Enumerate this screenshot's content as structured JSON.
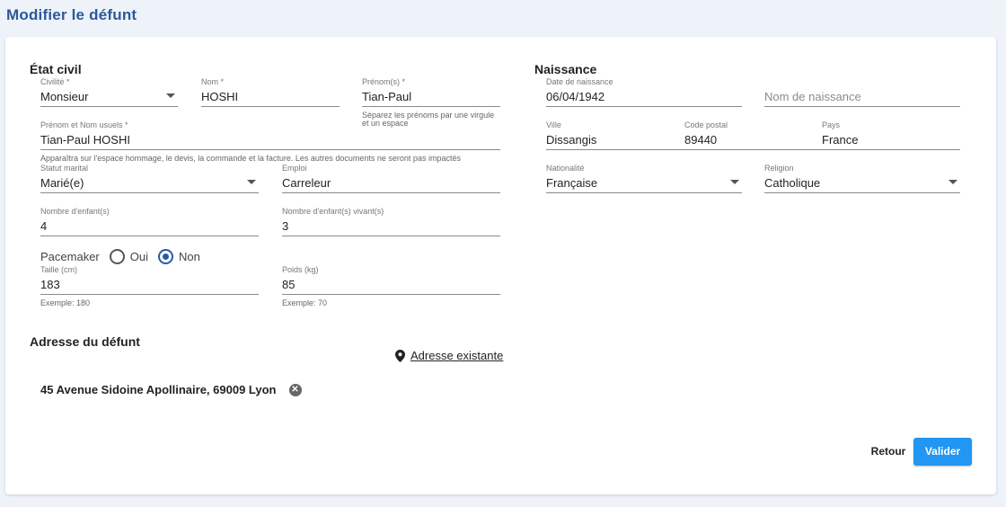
{
  "page": {
    "title": "Modifier le défunt"
  },
  "etat_civil": {
    "title": "État civil",
    "civilite": {
      "label": "Civilité *",
      "value": "Monsieur"
    },
    "nom": {
      "label": "Nom *",
      "value": "HOSHI"
    },
    "prenoms": {
      "label": "Prénom(s) *",
      "value": "Tian-Paul",
      "hint": "Séparez les prénoms par une virgule et un espace"
    },
    "prenom_nom_usuels": {
      "label": "Prénom et Nom usuels *",
      "value": "Tian-Paul HOSHI",
      "hint": "Apparaîtra sur l'espace hommage, le devis, la commande et la facture. Les autres documents ne seront pas impactés"
    },
    "statut_marital": {
      "label": "Statut marital",
      "value": "Marié(e)"
    },
    "emploi": {
      "label": "Emploi",
      "value": "Carreleur"
    },
    "nombre_enfants": {
      "label": "Nombre d'enfant(s)",
      "value": "4"
    },
    "nombre_enfants_vivants": {
      "label": "Nombre d'enfant(s) vivant(s)",
      "value": "3"
    },
    "pacemaker": {
      "label": "Pacemaker",
      "option_oui": "Oui",
      "option_non": "Non",
      "selected": "Non"
    },
    "taille": {
      "label": "Taille (cm)",
      "value": "183",
      "hint": "Exemple: 180"
    },
    "poids": {
      "label": "Poids (kg)",
      "value": "85",
      "hint": "Exemple: 70"
    }
  },
  "naissance": {
    "title": "Naissance",
    "date": {
      "label": "Date de naissance",
      "value": "06/04/1942"
    },
    "nom_naissance": {
      "placeholder": "Nom de naissance"
    },
    "ville": {
      "label": "Ville",
      "value": "Dissangis"
    },
    "code_postal": {
      "label": "Code postal",
      "value": "89440"
    },
    "pays": {
      "label": "Pays",
      "value": "France"
    },
    "nationalite": {
      "label": "Nationalité",
      "value": "Française"
    },
    "religion": {
      "label": "Religion",
      "value": "Catholique"
    }
  },
  "adresse": {
    "title": "Adresse du défunt",
    "link_label": "Adresse existante",
    "link_icon": "map-pin-icon",
    "value": "45 Avenue Sidoine Apollinaire, 69009 Lyon",
    "clear_icon": "close-circle-icon"
  },
  "actions": {
    "retour": "Retour",
    "valider": "Valider"
  },
  "colors": {
    "title": "#2a5a9a",
    "primary": "#2196f3",
    "radio_selected": "#2a5aa8"
  }
}
